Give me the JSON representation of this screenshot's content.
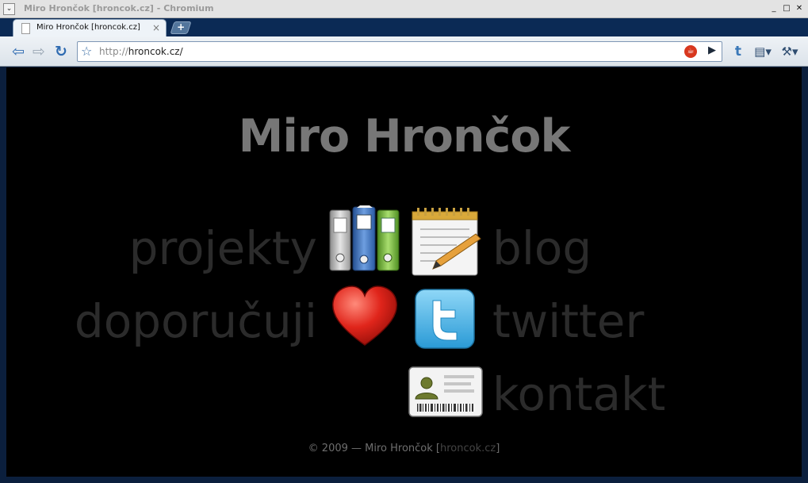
{
  "window": {
    "title": "Miro Hrončok [hroncok.cz] - Chromium",
    "menu_glyph": "⌄",
    "buttons": [
      "_",
      "□",
      "✕"
    ]
  },
  "tabs": [
    {
      "label": "Miro Hrončok [hroncok.cz]",
      "close_glyph": "×"
    }
  ],
  "newtab_glyph": "+",
  "toolbar": {
    "back_glyph": "⇦",
    "forward_glyph": "⇨",
    "reload_glyph": "↻",
    "star_glyph": "☆",
    "url_scheme": "http://",
    "url_rest": "hroncok.cz/",
    "go_glyph": "▶",
    "extension_icon": "cup-icon",
    "t_glyph": "t",
    "page_glyph": "▤▾",
    "wrench_glyph": "⚒▾"
  },
  "page": {
    "heading": "Miro Hrončok",
    "menu": {
      "projekty": "projekty",
      "blog": "blog",
      "doporucuji": "doporučuji",
      "twitter": "twitter",
      "kontakt": "kontakt"
    },
    "footer": {
      "prefix": "© 2009 — Miro Hrončok [",
      "domain": "hroncok.cz",
      "suffix": "]"
    }
  },
  "colors": {
    "heading": "#777777",
    "menu_text": "#2b2b2b",
    "background": "#000000",
    "footer": "#6e6e6e"
  }
}
